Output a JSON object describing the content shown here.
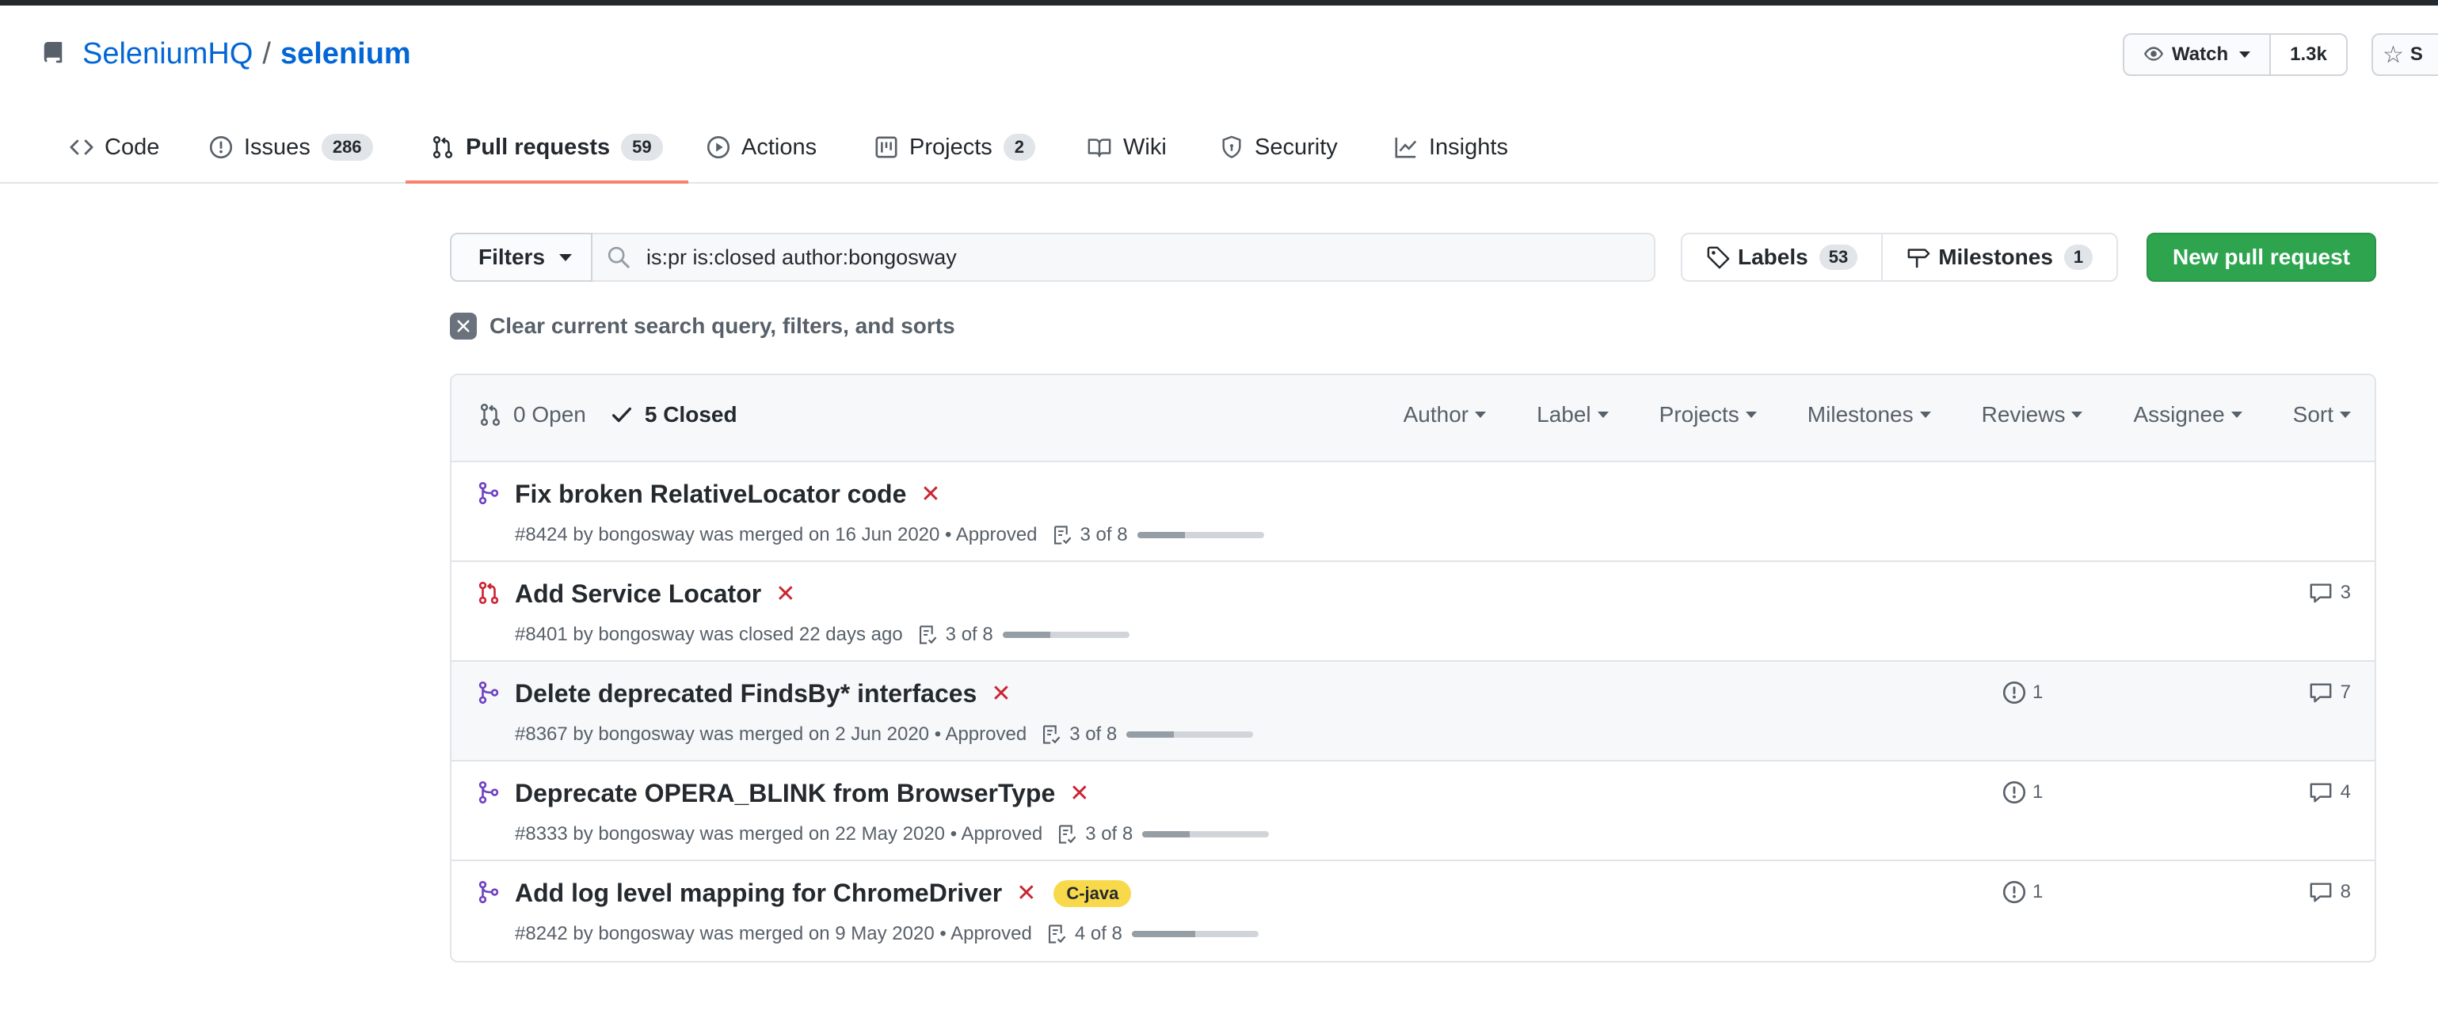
{
  "repo": {
    "owner": "SeleniumHQ",
    "separator": "/",
    "name": "selenium"
  },
  "actions": {
    "watch_label": "Watch",
    "watch_count": "1.3k",
    "star_label": "S"
  },
  "tabs": [
    {
      "label": "Code",
      "counter": null,
      "icon": "code-icon"
    },
    {
      "label": "Issues",
      "counter": "286",
      "icon": "issue-icon"
    },
    {
      "label": "Pull requests",
      "counter": "59",
      "icon": "pull-request-icon"
    },
    {
      "label": "Actions",
      "counter": null,
      "icon": "play-icon"
    },
    {
      "label": "Projects",
      "counter": "2",
      "icon": "project-icon"
    },
    {
      "label": "Wiki",
      "counter": null,
      "icon": "book-icon"
    },
    {
      "label": "Security",
      "counter": null,
      "icon": "shield-icon"
    },
    {
      "label": "Insights",
      "counter": null,
      "icon": "graph-icon"
    }
  ],
  "toolbar": {
    "filters_label": "Filters",
    "search_value": "is:pr is:closed author:bongosway",
    "labels_label": "Labels",
    "labels_count": "53",
    "milestones_label": "Milestones",
    "milestones_count": "1",
    "new_pr_label": "New pull request",
    "clear_label": "Clear current search query, filters, and sorts"
  },
  "list_header": {
    "open_label": "0 Open",
    "closed_label": "5 Closed",
    "filters": [
      "Author",
      "Label",
      "Projects",
      "Milestones",
      "Reviews",
      "Assignee",
      "Sort"
    ]
  },
  "prs": [
    {
      "title": "Fix broken RelativeLocator code",
      "status": "merged",
      "fail_mark": "✕",
      "label": null,
      "meta": "#8424 by bongosway was merged on 16 Jun 2020 • Approved",
      "tasks": "3 of 8",
      "progress": 0.375,
      "issues": null,
      "comments": null
    },
    {
      "title": "Add Service Locator",
      "status": "closed",
      "fail_mark": "✕",
      "label": null,
      "meta": "#8401 by bongosway was closed 22 days ago",
      "tasks": "3 of 8",
      "progress": 0.375,
      "issues": null,
      "comments": "3"
    },
    {
      "title": "Delete deprecated FindsBy* interfaces",
      "status": "merged",
      "fail_mark": "✕",
      "label": null,
      "meta": "#8367 by bongosway was merged on 2 Jun 2020 • Approved",
      "tasks": "3 of 8",
      "progress": 0.375,
      "issues": "1",
      "comments": "7"
    },
    {
      "title": "Deprecate OPERA_BLINK from BrowserType",
      "status": "merged",
      "fail_mark": "✕",
      "label": null,
      "meta": "#8333 by bongosway was merged on 22 May 2020 • Approved",
      "tasks": "3 of 8",
      "progress": 0.375,
      "issues": "1",
      "comments": "4"
    },
    {
      "title": "Add log level mapping for ChromeDriver",
      "status": "merged",
      "fail_mark": "✕",
      "label": "C-java",
      "meta": "#8242 by bongosway was merged on 9 May 2020 • Approved",
      "tasks": "4 of 8",
      "progress": 0.5,
      "issues": "1",
      "comments": "8"
    }
  ],
  "colors": {
    "merged": "#6f42c1",
    "closed": "#cb2431",
    "link": "#0366d6",
    "primary": "#2ea44f",
    "tab_underline": "#f9826c"
  }
}
